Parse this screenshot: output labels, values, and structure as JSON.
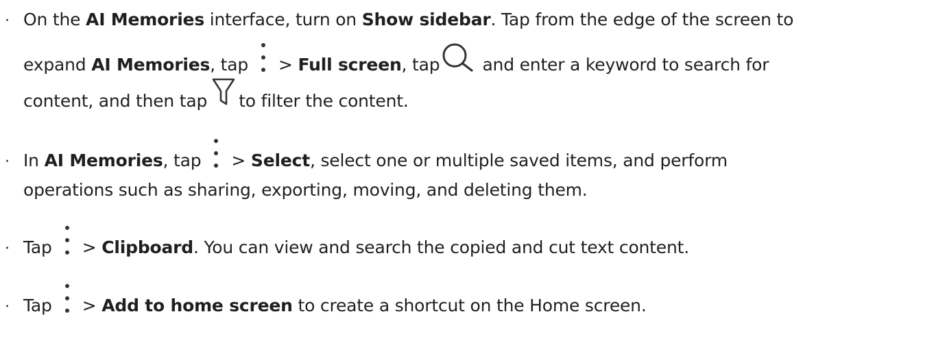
{
  "items": [
    {
      "lines": [
        {
          "segments": [
            {
              "text": "On the ",
              "bold": false
            },
            {
              "text": "AI Memories",
              "bold": true
            },
            {
              "text": " interface, turn on ",
              "bold": false
            },
            {
              "text": "Show sidebar",
              "bold": true
            },
            {
              "text": ". Tap from the edge of the screen to",
              "bold": false
            }
          ]
        },
        {
          "segments": [
            {
              "text": "expand ",
              "bold": false
            },
            {
              "text": "AI Memories",
              "bold": true
            },
            {
              "text": ", tap",
              "bold": false
            },
            {
              "icon": "more-vertical-icon"
            },
            {
              "text": "> ",
              "bold": false
            },
            {
              "text": "Full screen",
              "bold": true
            },
            {
              "text": ", tap",
              "bold": false
            },
            {
              "icon": "search-icon"
            },
            {
              "text": "and enter a keyword to search for",
              "bold": false
            }
          ]
        },
        {
          "segments": [
            {
              "text": "content, and then tap",
              "bold": false
            },
            {
              "icon": "filter-icon"
            },
            {
              "text": "to filter the content.",
              "bold": false
            }
          ]
        }
      ]
    },
    {
      "lines": [
        {
          "segments": [
            {
              "text": "In ",
              "bold": false
            },
            {
              "text": "AI Memories",
              "bold": true
            },
            {
              "text": ", tap",
              "bold": false
            },
            {
              "icon": "more-vertical-icon"
            },
            {
              "text": "> ",
              "bold": false
            },
            {
              "text": "Select",
              "bold": true
            },
            {
              "text": ", select one or multiple saved items, and perform",
              "bold": false
            }
          ]
        },
        {
          "segments": [
            {
              "text": "operations such as sharing, exporting, moving, and deleting them.",
              "bold": false
            }
          ]
        }
      ]
    },
    {
      "lines": [
        {
          "segments": [
            {
              "text": "Tap",
              "bold": false
            },
            {
              "icon": "more-vertical-icon"
            },
            {
              "text": "> ",
              "bold": false
            },
            {
              "text": "Clipboard",
              "bold": true
            },
            {
              "text": ". You can view and search the copied and cut text content.",
              "bold": false
            }
          ]
        }
      ]
    },
    {
      "lines": [
        {
          "segments": [
            {
              "text": "Tap",
              "bold": false
            },
            {
              "icon": "more-vertical-icon"
            },
            {
              "text": "> ",
              "bold": false
            },
            {
              "text": "Add to home screen",
              "bold": true
            },
            {
              "text": " to create a shortcut on the Home screen.",
              "bold": false
            }
          ]
        }
      ]
    }
  ]
}
